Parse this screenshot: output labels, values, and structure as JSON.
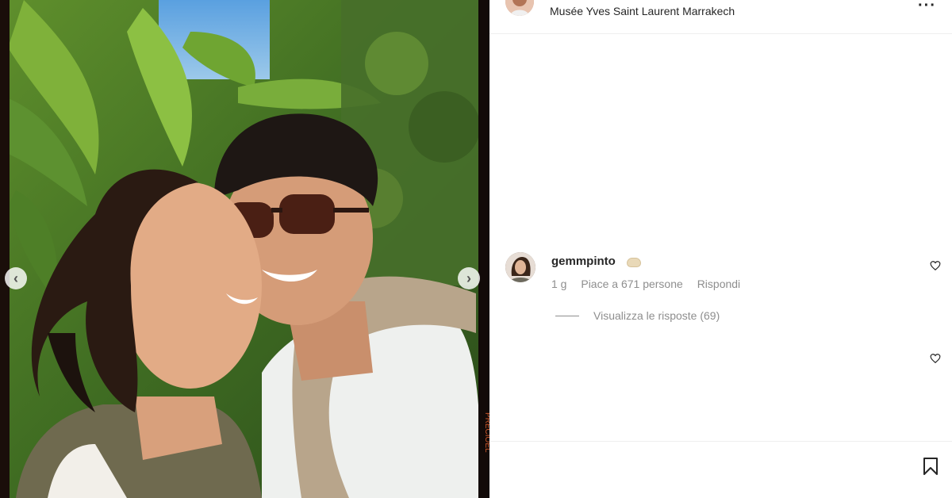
{
  "post": {
    "location": "Musée Yves Saint Laurent Marrakech",
    "more_icon": "more-horizontal-icon"
  },
  "media": {
    "prev_icon": "chevron-left-icon",
    "next_icon": "chevron-right-icon",
    "film_edge_text": "PRECIOEL"
  },
  "comment": {
    "username": "gemmpinto",
    "badge_icon": "lips-emoji-icon",
    "time": "1 g",
    "likes": "Piace a 671 persone",
    "reply": "Rispondi",
    "view_replies": "Visualizza le risposte (69)"
  },
  "icons": {
    "like": "heart-icon",
    "save": "bookmark-icon"
  }
}
